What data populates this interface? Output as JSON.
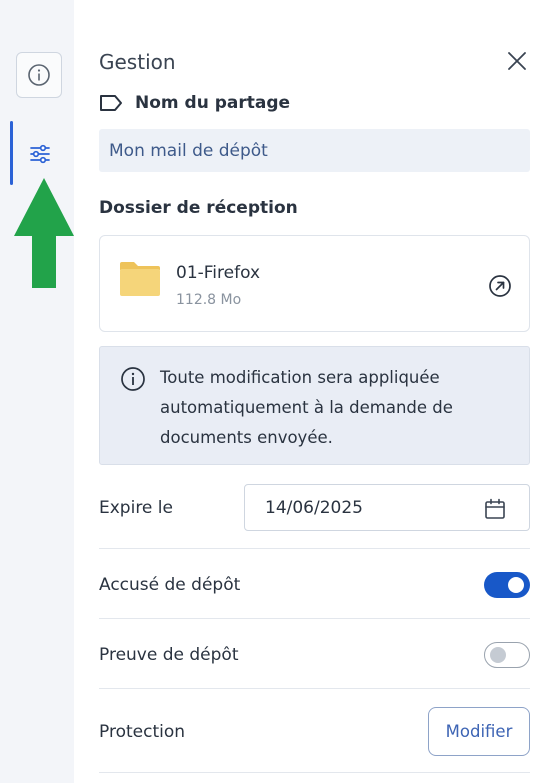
{
  "panel": {
    "title": "Gestion",
    "share_label": "Nom du partage",
    "share_name": "Mon mail de dépôt",
    "folder_section_label": "Dossier de réception",
    "folder": {
      "name": "01-Firefox",
      "size": "112.8 Mo"
    },
    "notice": "Toute modification sera appliquée automatiquement à la demande de documents envoyée.",
    "expiry_label": "Expire le",
    "expiry_date": "14/06/2025",
    "acknowledgment_label": "Accusé de dépôt",
    "acknowledgment_enabled": true,
    "proof_label": "Preuve de dépôt",
    "proof_enabled": false,
    "protection_label": "Protection",
    "modify_label": "Modifier"
  },
  "rail": {
    "icons": [
      "info-icon",
      "settings-sliders-icon"
    ],
    "active": "settings-sliders-icon"
  },
  "colors": {
    "accent": "#1858c8",
    "annotation_arrow": "#22a34a",
    "folder": "#f5d57a"
  }
}
